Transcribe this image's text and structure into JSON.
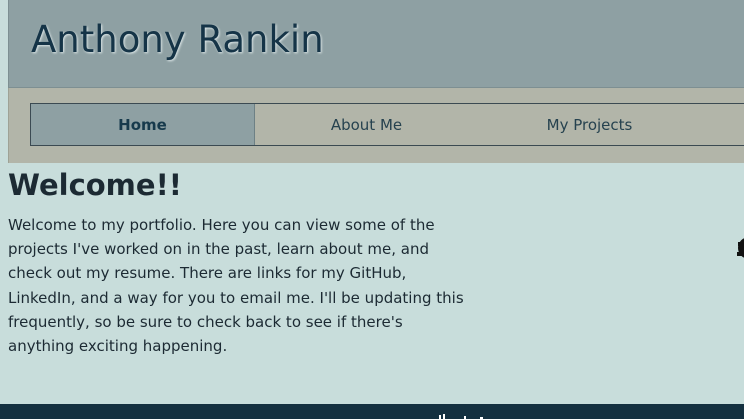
{
  "header": {
    "title": "Anthony Rankin"
  },
  "nav": {
    "items": [
      {
        "label": "Home"
      },
      {
        "label": "About Me"
      },
      {
        "label": "My Projects"
      }
    ]
  },
  "main": {
    "title": "Welcome!!",
    "text": "Welcome to my portfolio. Here you can view some of the projects I've worked on in the past, learn about me, and check out my resume. There are links for my GitHub, LinkedIn, and a way for you to email me. I'll be updating this frequently, so be sure to check back to see if there's anything exciting happening."
  },
  "colors": {
    "page_background": "#c8dddb",
    "header_background": "#8ea0a3",
    "nav_background": "#b2b5a9",
    "footer_background": "#143040",
    "title_color": "#153447"
  },
  "icons": {
    "side": "github-icon",
    "footer": "footer-icons"
  }
}
